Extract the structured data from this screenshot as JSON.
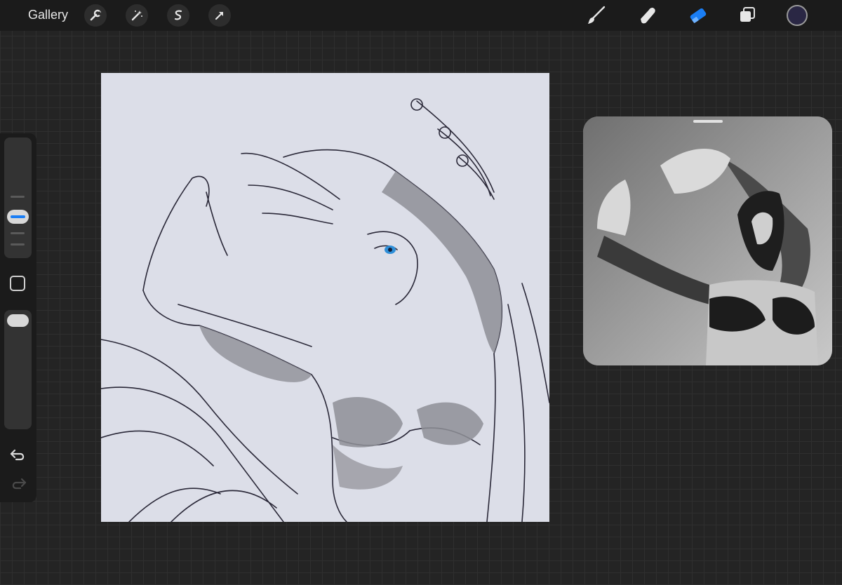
{
  "topbar": {
    "gallery_label": "Gallery",
    "left_tools": [
      "wrench-icon",
      "magic-wand-icon",
      "selection-icon",
      "transform-arrow-icon"
    ],
    "right_tools": [
      "brush-icon",
      "smudge-icon",
      "eraser-icon",
      "layers-icon"
    ],
    "active_tool": "eraser",
    "accent_color": "#1a7ef5",
    "current_color": "#2a2744"
  },
  "sidebar": {
    "brush_size_level": 0.45,
    "opacity_level": 1.0,
    "icons": [
      "modify-square-icon",
      "undo-icon",
      "redo-icon"
    ]
  },
  "canvas": {
    "background_color": "#dcdee8",
    "content": "artwork"
  },
  "reference": {
    "content": "reference-photo"
  }
}
